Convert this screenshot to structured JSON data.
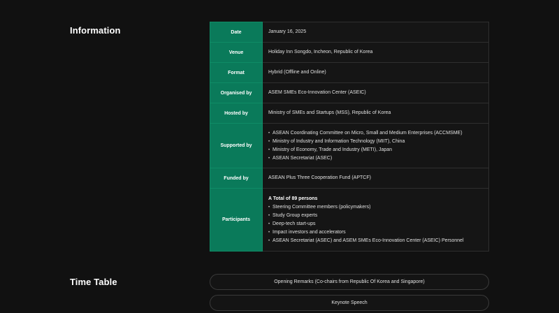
{
  "information": {
    "heading": "Information",
    "rows": [
      {
        "label": "Date",
        "value": "January 16, 2025"
      },
      {
        "label": "Venue",
        "value": "Holiday Inn Songdo, Incheon, Republic of Korea"
      },
      {
        "label": "Format",
        "value": "Hybrid (Offline and Online)"
      },
      {
        "label": "Organised by",
        "value": "ASEM SMEs Eco-Innovation Center (ASEIC)"
      },
      {
        "label": "Hosted by",
        "value": "Ministry of SMEs and Startups (MSS), Republic of Korea"
      },
      {
        "label": "Supported by",
        "items": [
          "ASEAN Coordinating Committee on Micro, Small and Medium Enterprises (ACCMSME)",
          "Ministry of Industry and Information Technology (MIIT), China",
          "Ministry of Economy, Trade and Industry (METI), Japan",
          "ASEAN Secretariat (ASEC)"
        ]
      },
      {
        "label": "Funded by",
        "value": "ASEAN Plus Three Cooperation Fund (APTCF)"
      },
      {
        "label": "Participants",
        "title": "A Total of 89 persons",
        "items": [
          "Steering Committee members (policymakers)",
          "Study Group experts",
          "Deep-tech start-ups",
          "Impact investors and accelerators",
          "ASEAN Secretariat (ASEC) and ASEM SMEs Eco-Innovation Center (ASEIC) Personnel"
        ]
      }
    ]
  },
  "timetable": {
    "heading": "Time Table",
    "items": [
      "Opening Remarks (Co-chairs from Republic Of Korea and Singapore)",
      "Keynote Speech"
    ]
  }
}
